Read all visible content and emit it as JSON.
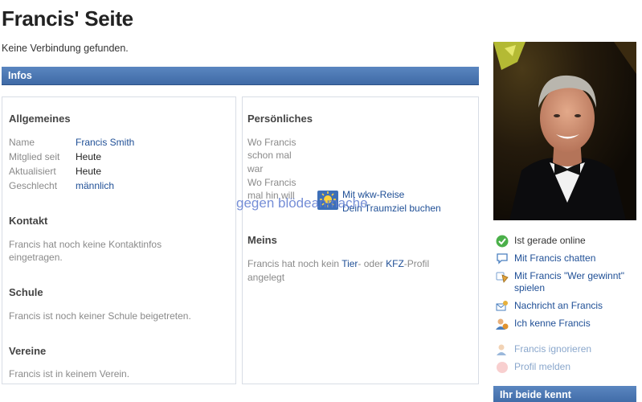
{
  "page": {
    "title": "Francis' Seite",
    "connection": "Keine Verbindung gefunden."
  },
  "infos": {
    "heading": "Infos"
  },
  "allgemeines": {
    "heading": "Allgemeines",
    "rows": [
      {
        "label": "Name",
        "value": "Francis Smith"
      },
      {
        "label": "Mitglied seit",
        "value": "Heute"
      },
      {
        "label": "Aktualisiert",
        "value": "Heute"
      },
      {
        "label": "Geschlecht",
        "value": "männlich"
      }
    ]
  },
  "kontakt": {
    "heading": "Kontakt",
    "line1": "Francis hat noch keine Kontaktinfos",
    "line2": "eingetragen."
  },
  "schule": {
    "heading": "Schule",
    "text": "Francis ist noch keiner Schule beigetreten."
  },
  "vereine": {
    "heading": "Vereine",
    "text": "Francis ist in keinem Verein."
  },
  "persoenliches": {
    "heading": "Persönliches",
    "lines": [
      "Wo Francis",
      "schon mal",
      "war",
      "Wo Francis",
      "mal hin will"
    ]
  },
  "meins": {
    "heading": "Meins",
    "prefix": "Francis hat noch kein ",
    "tier": "Tier",
    "middle": "- oder ",
    "kfz": "KFZ",
    "suffix": "-Profil",
    "line2": "angelegt"
  },
  "ad": {
    "line1": "Mit wkw-Reise",
    "line2": "Dein Traumziel buchen"
  },
  "overlay": {
    "text": "gegen blödeanmache"
  },
  "actions": {
    "online": "Ist gerade online",
    "chat": "Mit Francis chatten",
    "game_line1": "Mit Francis \"Wer gewinnt\"",
    "game_line2": "spielen",
    "message": "Nachricht an Francis",
    "know": "Ich kenne Francis",
    "ignore": "Francis ignorieren",
    "report": "Profil melden"
  },
  "beide": {
    "heading": "Ihr beide kennt"
  },
  "colors": {
    "bar": "#4a76b2",
    "link": "#1f4f96",
    "muted": "#8a8a8a"
  }
}
